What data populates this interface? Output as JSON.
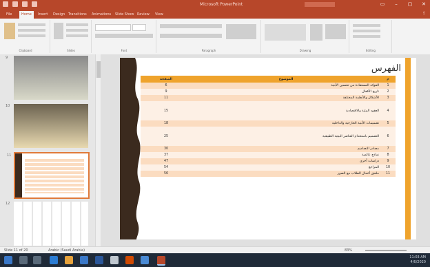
{
  "window": {
    "title": "Microsoft PowerPoint"
  },
  "ribbon": {
    "tabs": [
      "File",
      "Home",
      "Insert",
      "Design",
      "Transitions",
      "Animations",
      "Slide Show",
      "Review",
      "View"
    ],
    "active_tab": "Home",
    "groups": [
      "Clipboard",
      "Slides",
      "Font",
      "Paragraph",
      "Drawing",
      "Editing"
    ]
  },
  "slides_panel": {
    "numbers": [
      "9",
      "10",
      "11",
      "12"
    ],
    "selected": "11"
  },
  "slide": {
    "title": "الفهرس",
    "table_headers": {
      "index": "م",
      "topic": "الموضوع",
      "page": "الصفحة"
    },
    "rows": [
      {
        "index": "1",
        "topic": "الفوائد المستفادة من تحسين الأبنية",
        "page": "6"
      },
      {
        "index": "2",
        "topic": "تاريخ الأقفال",
        "page": "9"
      },
      {
        "index": "3",
        "topic": "الأشكال والأنظمة المختلفة",
        "page": "11"
      },
      {
        "index": "4",
        "topic": "العقود البيئية والاقتصادية",
        "page": "15"
      },
      {
        "index": "5",
        "topic": "تصميمات الأبنية الخارجية والداخلية",
        "page": "18"
      },
      {
        "index": "6",
        "topic": "التصميم باستخدام العناصر البيئية الطبيعية",
        "page": "25"
      },
      {
        "index": "7",
        "topic": "مصادر التصاميم",
        "page": "30"
      },
      {
        "index": "8",
        "topic": "نماذج عالمية",
        "page": "37"
      },
      {
        "index": "9",
        "topic": "دراسات أخرى",
        "page": "47"
      },
      {
        "index": "10",
        "topic": "المراجع",
        "page": "54"
      },
      {
        "index": "11",
        "topic": "ملحق أعمال الطلاب مع الصور",
        "page": "56"
      }
    ]
  },
  "status": {
    "slide_info": "Slide 11 of 20",
    "language": "Arabic (Saudi Arabia)",
    "zoom": "83%"
  },
  "taskbar": {
    "time": "11:03 AM",
    "date": "4/6/2020"
  },
  "colors": {
    "accent": "#b7472a",
    "slide_orange": "#efa32c",
    "wave_dark": "#3b2a1e"
  }
}
